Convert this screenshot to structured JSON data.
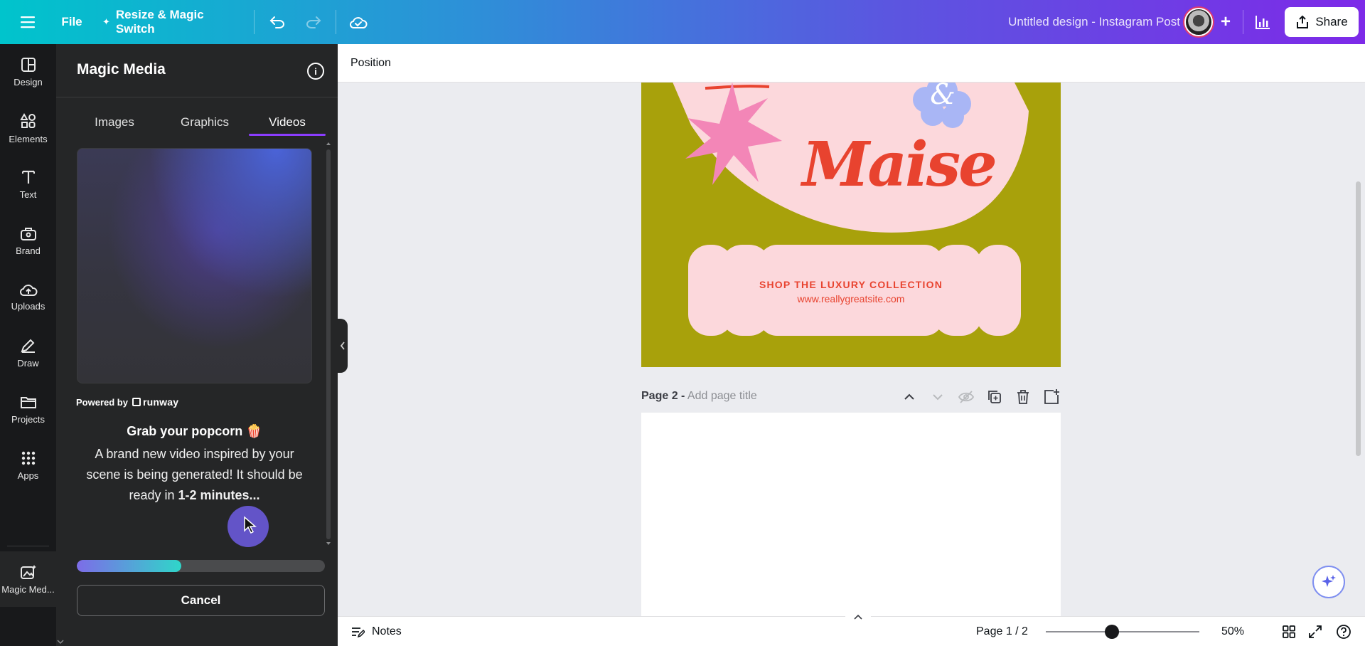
{
  "topbar": {
    "file_label": "File",
    "resize_label": "Resize & Magic Switch",
    "design_title": "Untitled design - Instagram Post",
    "share_label": "Share"
  },
  "rail": {
    "items": [
      {
        "label": "Design",
        "icon": "layout-icon"
      },
      {
        "label": "Elements",
        "icon": "shapes-icon"
      },
      {
        "label": "Text",
        "icon": "text-icon"
      },
      {
        "label": "Brand",
        "icon": "briefcase-icon"
      },
      {
        "label": "Uploads",
        "icon": "cloud-upload-icon"
      },
      {
        "label": "Draw",
        "icon": "pen-icon"
      },
      {
        "label": "Projects",
        "icon": "folder-icon"
      },
      {
        "label": "Apps",
        "icon": "apps-grid-icon"
      },
      {
        "label": "Magic Med...",
        "icon": "magic-media-icon"
      }
    ]
  },
  "panel": {
    "title": "Magic Media",
    "tabs": [
      "Images",
      "Graphics",
      "Videos"
    ],
    "active_tab": "Videos",
    "powered_by": "Powered by",
    "provider": "runway",
    "heading": "Grab your popcorn 🍿",
    "body_lead": "A brand new video inspired by your scene is being generated! It should be ready in ",
    "body_bold": "1-2 minutes...",
    "progress": 0.42,
    "cancel_label": "Cancel"
  },
  "canvas": {
    "context_label": "Position",
    "page1": {
      "brand_word": "Maise",
      "ampersand": "&",
      "cta": "SHOP THE LUXURY COLLECTION",
      "url": "www.reallygreatsite.com"
    },
    "page2": {
      "label": "Page 2 -",
      "placeholder": "Add page title"
    }
  },
  "footer": {
    "notes_label": "Notes",
    "page_indicator": "Page 1 / 2",
    "zoom": "50%",
    "zoom_level": 0.5
  },
  "colors": {
    "accent": "#8b3dff",
    "page_bg": "#a8a10b",
    "pink": "#fcd8dc",
    "red": "#e8432f",
    "star_pink": "#f386b7",
    "flower_blue": "#a9b6f5"
  }
}
